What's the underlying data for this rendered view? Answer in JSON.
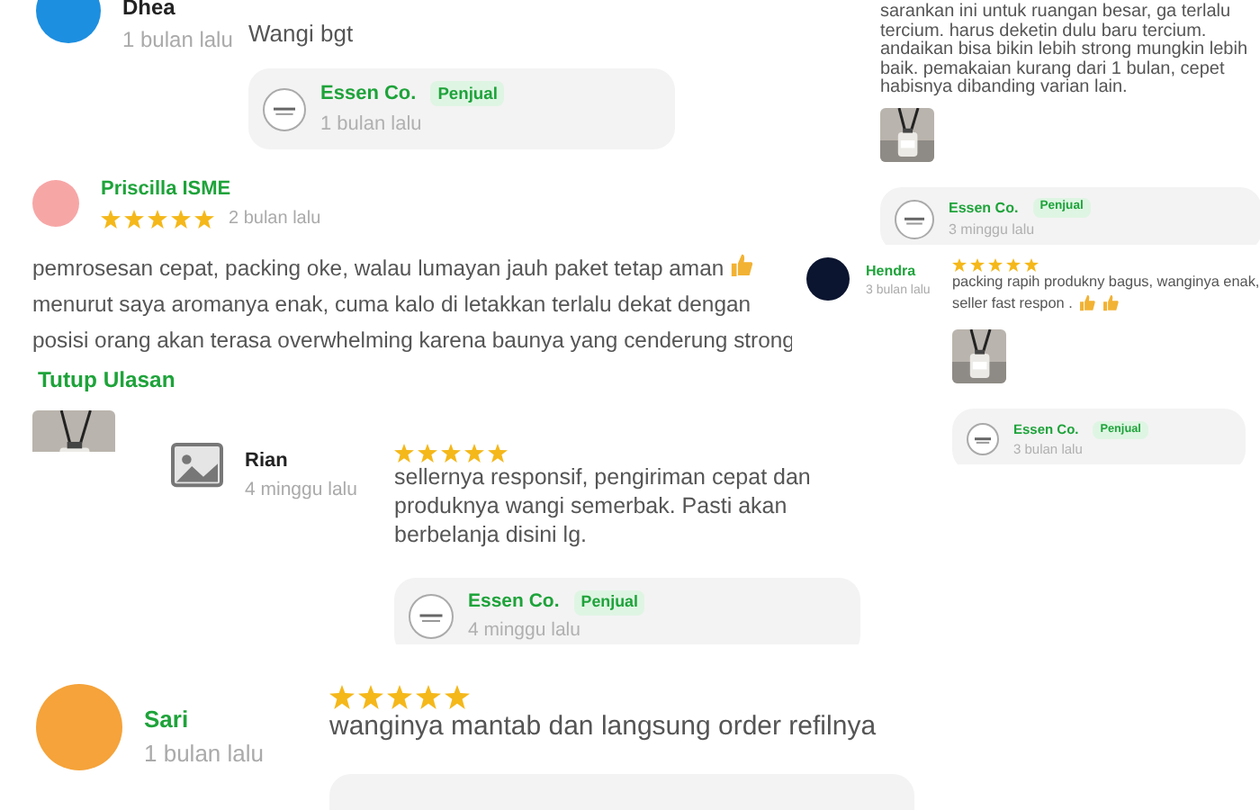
{
  "review_clips": [
    {
      "reviewer": {
        "name": "Dhea",
        "time": "1 bulan lalu",
        "avatar": {
          "kind": "circle",
          "color": "#1d8fe0"
        }
      },
      "text": "Wangi bgt",
      "reply": {
        "kind": "seller",
        "name": "Essen Co.",
        "badge": "Penjual",
        "time": "1 bulan lalu"
      }
    },
    {
      "text": "sarankan ini untuk ruangan besar, ga terlalu tercium. harus deketin dulu baru tercium. andaikan bisa bikin lebih strong mungkin lebih baik. pemakaian kurang dari 1 bulan, cepet habisnya dibanding varian lain.",
      "photo": {
        "kind": "picture"
      },
      "reply": {
        "kind": "seller",
        "name": "Essen Co.",
        "badge": "Penjual",
        "time": "3 minggu lalu"
      }
    },
    {
      "reviewer": {
        "name": "Priscilla ISME",
        "time": "2 bulan lalu",
        "avatar": {
          "kind": "circle",
          "color": "#f7a6a6"
        }
      },
      "stars": 5,
      "text": "pemrosesan cepat, packing oke, walau lumayan jauh paket tetap aman",
      "trailing_icons": [
        {
          "kind": "thumbs-up"
        }
      ],
      "text_2": "menurut saya aromanya enak, cuma kalo di letakkan terlalu dekat dengan posisi orang akan terasa overwhelming karena baunya yang cenderung strong",
      "link": "Tutup Ulasan",
      "photo": {
        "kind": "picture"
      }
    },
    {
      "reviewer": {
        "name": "Hendra",
        "time": "3 bulan lalu",
        "avatar": {
          "kind": "circle",
          "color": "#0b1530"
        }
      },
      "stars": 5,
      "text": "packing rapih produkny bagus, wanginya enak, seller fast respon .",
      "trailing_icons": [
        {
          "kind": "thumbs-up"
        },
        {
          "kind": "thumbs-up"
        }
      ],
      "photo": {
        "kind": "picture"
      },
      "reply": {
        "kind": "seller",
        "name": "Essen Co.",
        "badge": "Penjual",
        "time": "3 bulan lalu"
      }
    },
    {
      "reviewer": {
        "name": "Rian",
        "time": "4 minggu lalu",
        "avatar": {
          "kind": "placeholder"
        }
      },
      "stars": 5,
      "text": "sellernya responsif, pengiriman cepat dan produknya wangi semerbak. Pasti akan berbelanja disini lg.",
      "reply": {
        "kind": "seller",
        "name": "Essen Co.",
        "badge": "Penjual",
        "time": "4 minggu lalu"
      }
    },
    {
      "reviewer": {
        "name": "Sari",
        "time": "1 bulan lalu",
        "avatar": {
          "kind": "circle",
          "color": "#f5a33a"
        }
      },
      "stars": 5,
      "text": "wanginya mantab dan langsung order refilnya",
      "reply": {
        "kind": "empty"
      }
    }
  ]
}
